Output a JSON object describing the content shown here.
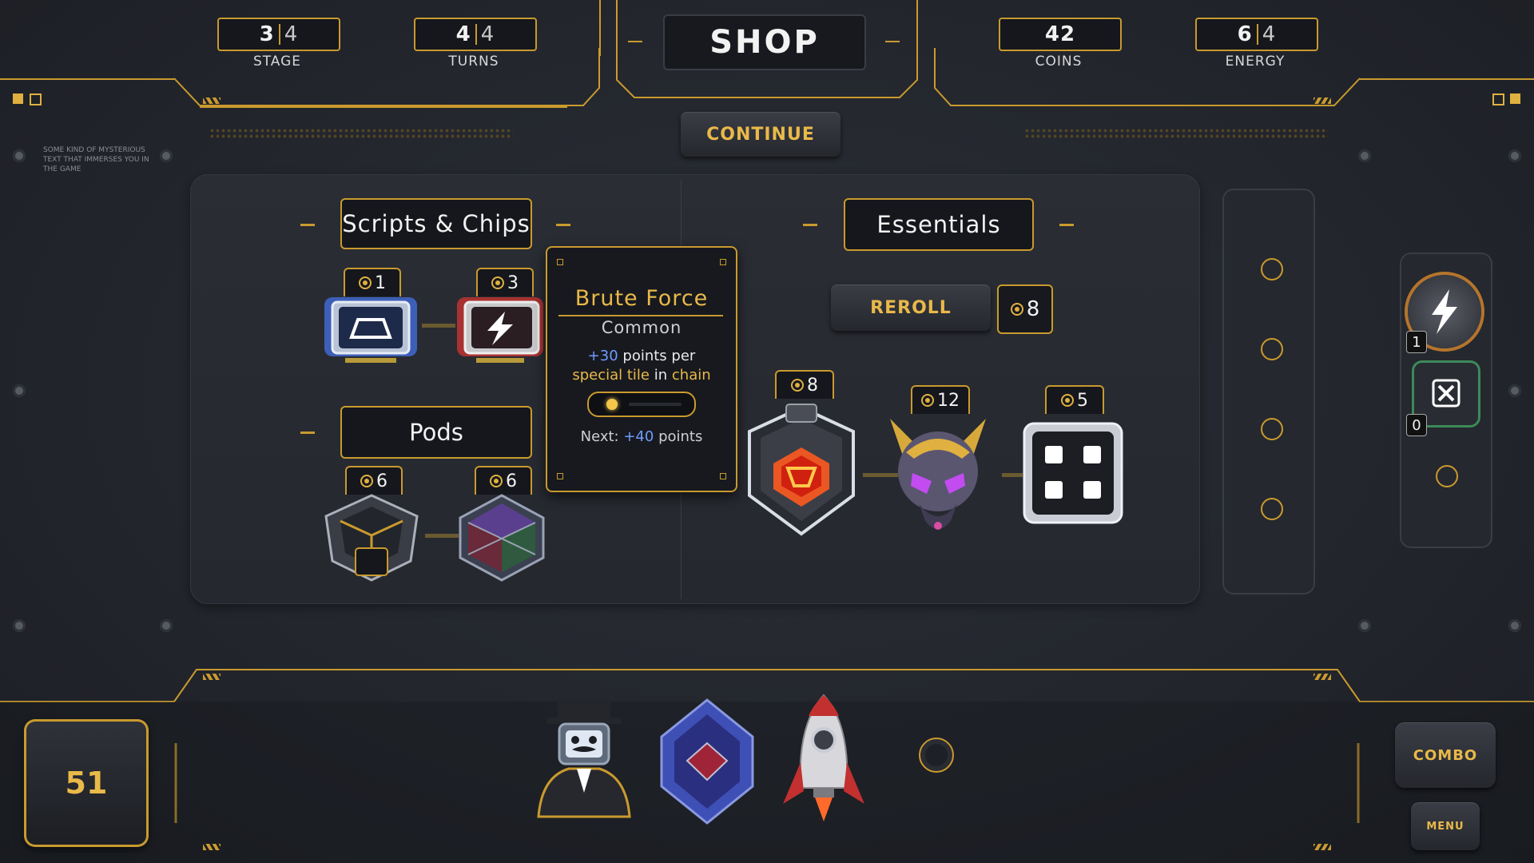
{
  "hud": {
    "stage": {
      "current": "3",
      "max": "4",
      "label": "STAGE"
    },
    "turns": {
      "current": "4",
      "max": "4",
      "label": "TURNS"
    },
    "coins": {
      "value": "42",
      "label": "COINS"
    },
    "energy": {
      "current": "6",
      "max": "4",
      "label": "ENERGY"
    },
    "title": "SHOP",
    "continue_label": "CONTINUE",
    "flavor_text": "SOME KIND OF MYSTERIOUS TEXT THAT IMMERSES YOU IN THE GAME"
  },
  "scripts_section": {
    "title": "Scripts & Chips",
    "items": [
      {
        "price": "1",
        "icon": "platform-chip-icon"
      },
      {
        "price": "3",
        "icon": "lightning-chip-icon"
      }
    ]
  },
  "pods_section": {
    "title": "Pods",
    "items": [
      {
        "price": "6",
        "icon": "dark-hex-pod-icon"
      },
      {
        "price": "6",
        "icon": "prism-pod-icon"
      }
    ]
  },
  "tooltip": {
    "name": "Brute Force",
    "rarity": "Common",
    "effect_amount": "+30",
    "effect_unit": "points per",
    "effect_special": "special tile",
    "effect_in": "in",
    "effect_chain": "chain",
    "level_fraction": 0.1,
    "next_label": "Next:",
    "next_amount": "+40",
    "next_unit": "points"
  },
  "essentials_section": {
    "title": "Essentials",
    "reroll_label": "REROLL",
    "reroll_cost": "8",
    "items": [
      {
        "price": "8",
        "icon": "red-gem-shield-icon"
      },
      {
        "price": "12",
        "icon": "alien-mask-icon"
      },
      {
        "price": "5",
        "icon": "four-squares-icon"
      }
    ]
  },
  "powerups": {
    "lightning_count": "1",
    "cancel_count": "0"
  },
  "bottom": {
    "score": "51",
    "combo_label": "COMBO",
    "menu_label": "MENU",
    "inventory": [
      "gentleman-robot-icon",
      "blue-crystal-icon",
      "rocket-icon"
    ]
  },
  "colors": {
    "accent": "#c99a2e",
    "gold_text": "#e9b949",
    "blue_text": "#6f9bff",
    "panel": "#15171c"
  }
}
